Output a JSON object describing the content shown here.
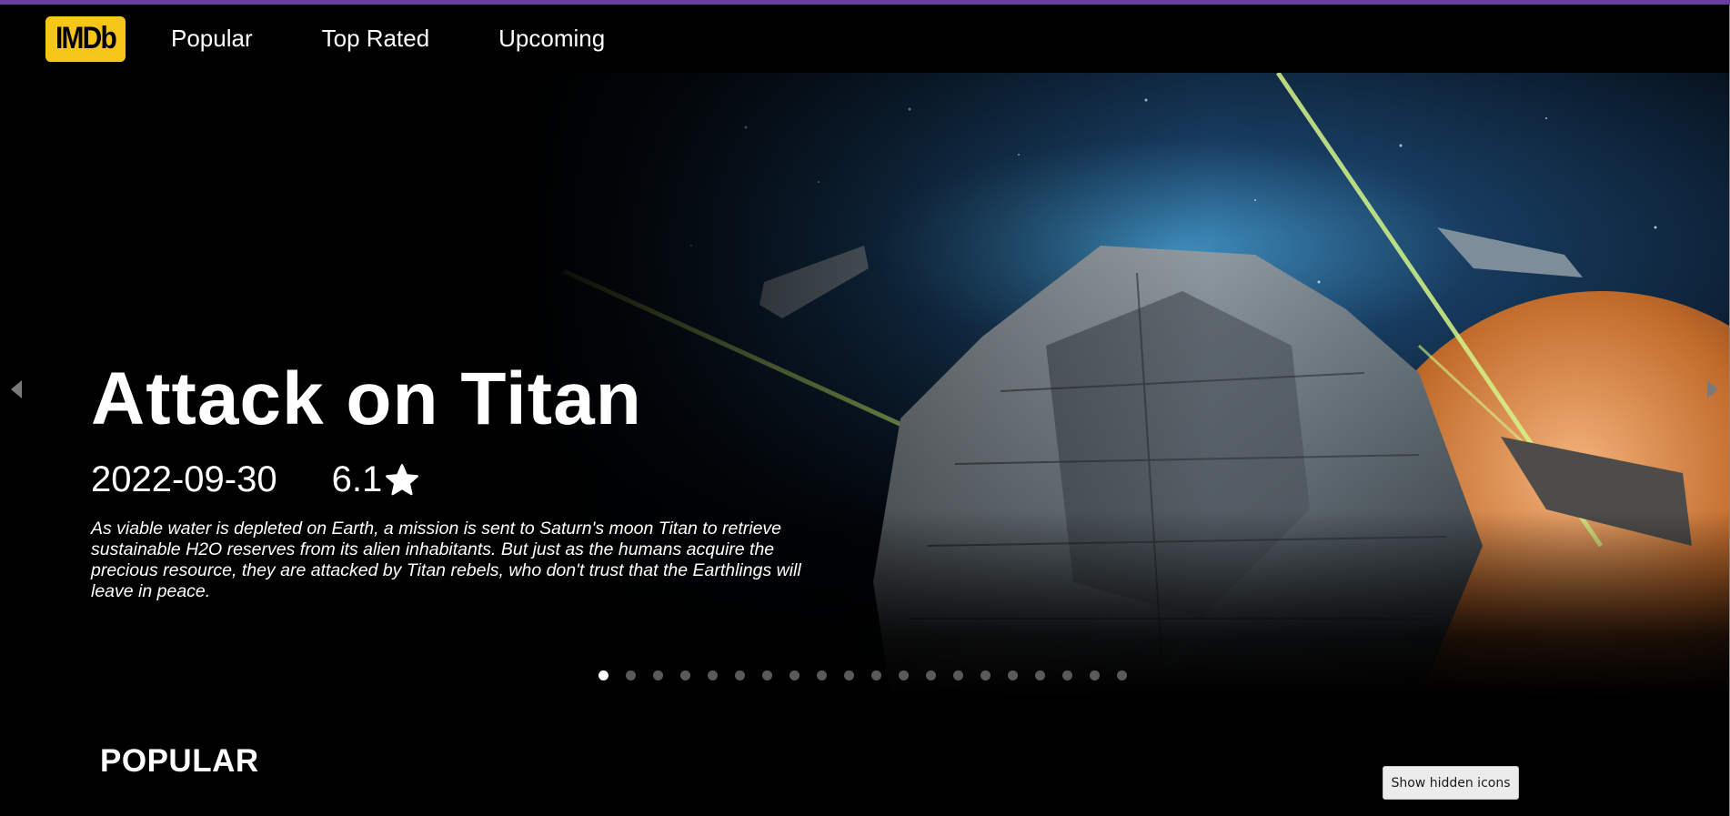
{
  "header": {
    "logo_text": "IMDb",
    "nav": [
      {
        "label": "Popular"
      },
      {
        "label": "Top Rated"
      },
      {
        "label": "Upcoming"
      }
    ]
  },
  "hero": {
    "title": "Attack on Titan",
    "release_date": "2022-09-30",
    "rating": "6.1",
    "overview": "As viable water is depleted on Earth, a mission is sent to Saturn's moon Titan to retrieve sustainable H2O reserves from its alien inhabitants. But just as the humans acquire the precious resource, they are attacked by Titan rebels, who don't trust that the Earthlings will leave in peace.",
    "slide_count": 20,
    "active_slide": 1
  },
  "sections": {
    "popular_title": "POPULAR"
  },
  "tooltip": {
    "text": "Show hidden icons"
  },
  "colors": {
    "brand": "#f5c518",
    "background": "#000000",
    "top_border": "#6a3ea1"
  }
}
